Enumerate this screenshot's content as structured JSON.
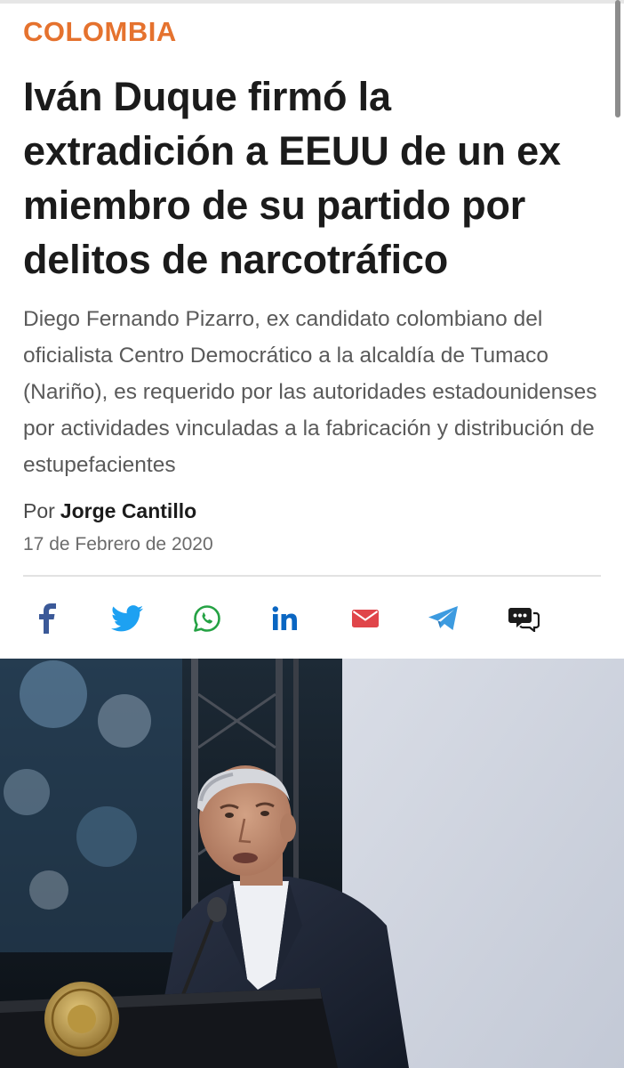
{
  "article": {
    "section": "COLOMBIA",
    "headline": "Iván Duque firmó la extradición a EEUU de un ex miembro de su partido por delitos de narcotráfico",
    "subheadline": "Diego Fernando Pizarro, ex candidato colombiano del oficialista Centro Democrático a la alcaldía de Tumaco (Nariño), es requerido por las autoridades estadounidenses por actividades vinculadas a la fabricación y distribución de estupefacientes",
    "byline_prefix": "Por",
    "author": "Jorge Cantillo",
    "date": "17 de Febrero de 2020"
  },
  "share": {
    "buttons": [
      {
        "icon": "facebook-icon",
        "color": "#3b5998"
      },
      {
        "icon": "twitter-icon",
        "color": "#1da1f2"
      },
      {
        "icon": "whatsapp-icon",
        "color": "#25a244"
      },
      {
        "icon": "linkedin-icon",
        "color": "#0a66c2"
      },
      {
        "icon": "email-icon",
        "color": "#e0454a"
      },
      {
        "icon": "telegram-icon",
        "color": "#3d9be0"
      },
      {
        "icon": "comments-icon",
        "color": "#1b1b1b"
      }
    ]
  },
  "colors": {
    "section_accent": "#e5722e",
    "headline": "#1b1b1b",
    "subheadline": "#5a5a5a"
  },
  "hero_image": {
    "subject": "man-speaking-at-podium-photo"
  }
}
